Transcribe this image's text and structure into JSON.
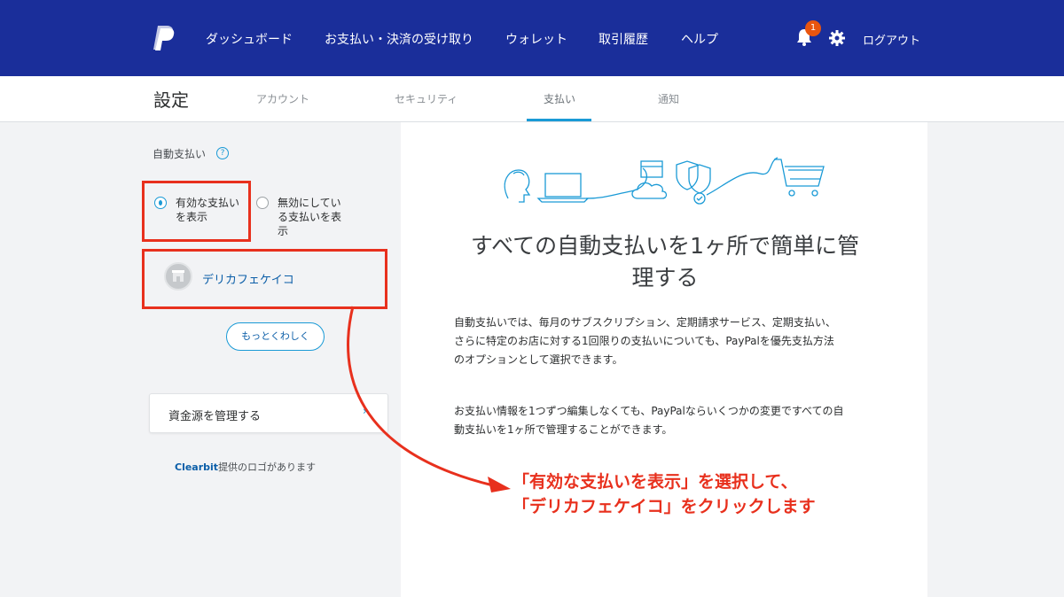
{
  "colors": {
    "header_bg": "#1a2e9a",
    "accent": "#1a9ad6",
    "link": "#0b5ea8",
    "annotation": "#e8301d",
    "badge": "#e9550f"
  },
  "header": {
    "logo_icon": "paypal-logo",
    "nav": [
      "ダッシュボード",
      "お支払い・決済の受け取り",
      "ウォレット",
      "取引履歴",
      "ヘルプ"
    ],
    "notification_count": "1",
    "logout": "ログアウト"
  },
  "tabs": {
    "page_title": "設定",
    "items": [
      "アカウント",
      "セキュリティ",
      "支払い",
      "通知"
    ],
    "active": "支払い"
  },
  "sidebar": {
    "section_label": "自動支払い",
    "help_icon": "?",
    "filter_options": [
      {
        "label": "有効な支払いを表示",
        "line1": "有効な支払い",
        "line2": "を表示",
        "checked": true
      },
      {
        "label": "無効にしている支払いを表示",
        "line1": "無効にしてい",
        "line2": "る支払いを表",
        "line3": "示",
        "checked": false
      }
    ],
    "merchant_name": "デリカフェケイコ",
    "more_button": "もっとくわしく",
    "funding_card_label": "資金源を管理する",
    "clearbit_brand": "Clearbit",
    "clearbit_suffix": "提供のロゴがあります"
  },
  "main": {
    "heading_line1": "すべての自動支払いを1ヶ所で簡単に管",
    "heading_line2": "理する",
    "para1_line1": "自動支払いでは、毎月のサブスクリプション、定期請求サービス、定期支払い、",
    "para1_line2": "さらに特定のお店に対する1回限りの支払いについても、PayPalを優先支払方法",
    "para1_line3": "のオプションとして選択できます。",
    "para2_line1": "お支払い情報を1つずつ編集しなくても、PayPalならいくつかの変更ですべての自",
    "para2_line2": "動支払いを1ヶ所で管理することができます。"
  },
  "annotation": {
    "line1": "「有効な支払いを表示」を選択して、",
    "line2": "「デリカフェケイコ」をクリックします"
  }
}
